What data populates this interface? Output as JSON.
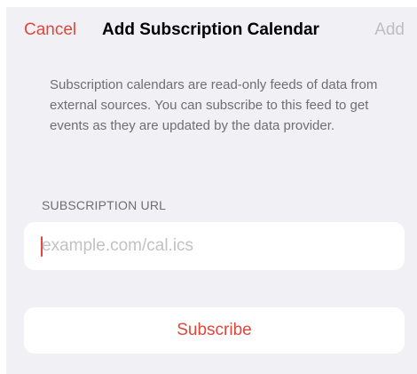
{
  "header": {
    "cancel_label": "Cancel",
    "title": "Add Subscription Calendar",
    "add_label": "Add"
  },
  "description": "Subscription calendars are read-only feeds of data from external sources. You can subscribe to this feed to get events as they are updated by the data provider.",
  "url_section": {
    "label": "SUBSCRIPTION URL",
    "placeholder": "example.com/cal.ics",
    "value": ""
  },
  "subscribe_label": "Subscribe",
  "colors": {
    "accent": "#e0463a",
    "background": "#f1f1f5",
    "secondary_text": "#6e6e73",
    "disabled_text": "#bdbdc2"
  }
}
